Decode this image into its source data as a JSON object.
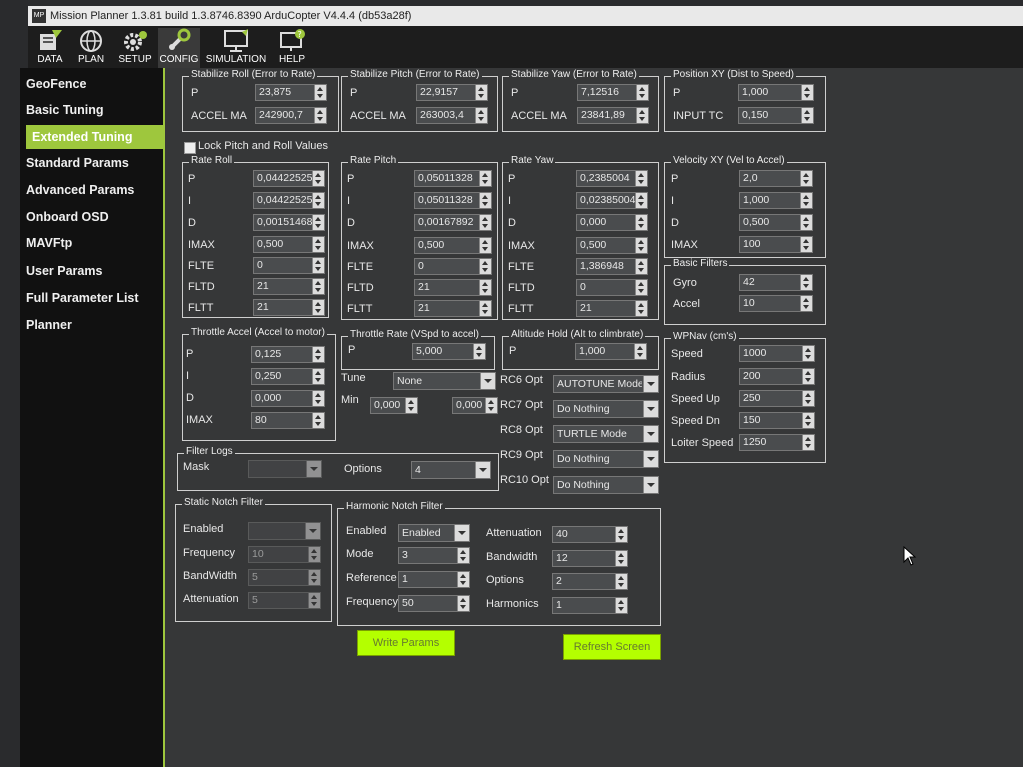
{
  "window": {
    "title": "Mission Planner 1.3.81 build 1.3.8746.8390 ArduCopter V4.4.4 (db53a28f)",
    "logo": "MP"
  },
  "toolbar": {
    "data": "DATA",
    "plan": "PLAN",
    "setup": "SETUP",
    "config": "CONFIG",
    "simulation": "SIMULATION",
    "help": "HELP"
  },
  "sidebar": {
    "items": [
      "GeoFence",
      "Basic Tuning",
      "Extended Tuning",
      "Standard Params",
      "Advanced Params",
      "Onboard OSD",
      "MAVFtp",
      "User Params",
      "Full Parameter List",
      "Planner"
    ]
  },
  "stab_roll": {
    "title": "Stabilize Roll (Error to Rate)",
    "p_label": "P",
    "p": "23,875",
    "accel_label": "ACCEL MA",
    "accel": "242900,7"
  },
  "stab_pitch": {
    "title": "Stabilize Pitch (Error to Rate)",
    "p_label": "P",
    "p": "22,9157",
    "accel_label": "ACCEL MA",
    "accel": "263003,4"
  },
  "stab_yaw": {
    "title": "Stabilize Yaw (Error to Rate)",
    "p_label": "P",
    "p": "7,12516",
    "accel_label": "ACCEL MA",
    "accel": "23841,89"
  },
  "pos_xy": {
    "title": "Position XY (Dist to Speed)",
    "p_label": "P",
    "p": "1,000",
    "inputtc_label": "INPUT TC",
    "inputtc": "0,150"
  },
  "lock_pitch_roll": {
    "label": "Lock Pitch and Roll Values"
  },
  "rate_labels": {
    "p": "P",
    "i": "I",
    "d": "D",
    "imax": "IMAX",
    "flte": "FLTE",
    "fltd": "FLTD",
    "fltt": "FLTT"
  },
  "rate_roll": {
    "title": "Rate Roll",
    "p": "0,04422525",
    "i": "0,04422525",
    "d": "0,00151468",
    "imax": "0,500",
    "flte": "0",
    "fltd": "21",
    "fltt": "21"
  },
  "rate_pitch": {
    "title": "Rate Pitch",
    "p": "0,05011328",
    "i": "0,05011328",
    "d": "0,00167892",
    "imax": "0,500",
    "flte": "0",
    "fltd": "21",
    "fltt": "21"
  },
  "rate_yaw": {
    "title": "Rate Yaw",
    "p": "0,2385004",
    "i": "0,02385004",
    "d": "0,000",
    "imax": "0,500",
    "flte": "1,386948",
    "fltd": "0",
    "fltt": "21"
  },
  "vel_xy": {
    "title": "Velocity XY (Vel to Accel)",
    "p_label": "P",
    "p": "2,0",
    "i_label": "I",
    "i": "1,000",
    "d_label": "D",
    "d": "0,500",
    "imax_label": "IMAX",
    "imax": "100"
  },
  "basic_filters": {
    "title": "Basic Filters",
    "gyro_label": "Gyro",
    "gyro": "42",
    "accel_label": "Accel",
    "accel": "10"
  },
  "throttle_accel": {
    "title": "Throttle Accel (Accel to motor)",
    "p_label": "P",
    "p": "0,125",
    "i_label": "I",
    "i": "0,250",
    "d_label": "D",
    "d": "0,000",
    "imax_label": "IMAX",
    "imax": "80"
  },
  "throttle_rate": {
    "title": "Throttle Rate (VSpd to accel)",
    "p_label": "P",
    "p": "5,000"
  },
  "altitude_hold": {
    "title": "Altitude Hold (Alt to climbrate)",
    "p_label": "P",
    "p": "1,000"
  },
  "tune": {
    "label": "Tune",
    "value": "None",
    "min_label": "Min",
    "min": "0,000",
    "max": "0,000"
  },
  "rc_opts": [
    {
      "label": "RC6 Opt",
      "value": "AUTOTUNE Mode"
    },
    {
      "label": "RC7 Opt",
      "value": "Do Nothing"
    },
    {
      "label": "RC8 Opt",
      "value": "TURTLE Mode"
    },
    {
      "label": "RC9 Opt",
      "value": "Do Nothing"
    },
    {
      "label": "RC10 Opt",
      "value": "Do Nothing"
    }
  ],
  "wpnav": {
    "title": "WPNav (cm's)",
    "speed_label": "Speed",
    "speed": "1000",
    "radius_label": "Radius",
    "radius": "200",
    "speedup_label": "Speed Up",
    "speedup": "250",
    "speeddn_label": "Speed Dn",
    "speeddn": "150",
    "loiter_label": "Loiter Speed",
    "loiter": "1250"
  },
  "filter_logs": {
    "title": "Filter Logs",
    "mask_label": "Mask",
    "mask": "",
    "options_label": "Options",
    "options": "4"
  },
  "static_notch": {
    "title": "Static Notch Filter",
    "enabled_label": "Enabled",
    "enabled": "",
    "freq_label": "Frequency",
    "freq": "10",
    "bw_label": "BandWidth",
    "bw": "5",
    "att_label": "Attenuation",
    "att": "5"
  },
  "harmonic_notch": {
    "title": "Harmonic Notch Filter",
    "enabled_label": "Enabled",
    "enabled": "Enabled",
    "mode_label": "Mode",
    "mode": "3",
    "ref_label": "Reference",
    "ref": "1",
    "freq_label": "Frequency",
    "freq": "50",
    "att_label": "Attenuation",
    "att": "40",
    "bw_label": "Bandwidth",
    "bw": "12",
    "options_label": "Options",
    "options": "2",
    "harm_label": "Harmonics",
    "harm": "1"
  },
  "buttons": {
    "write": "Write Params",
    "refresh": "Refresh Screen"
  },
  "colors": {
    "accent": "#9ec73d",
    "button": "#b4ff00",
    "bg": "#363738"
  }
}
